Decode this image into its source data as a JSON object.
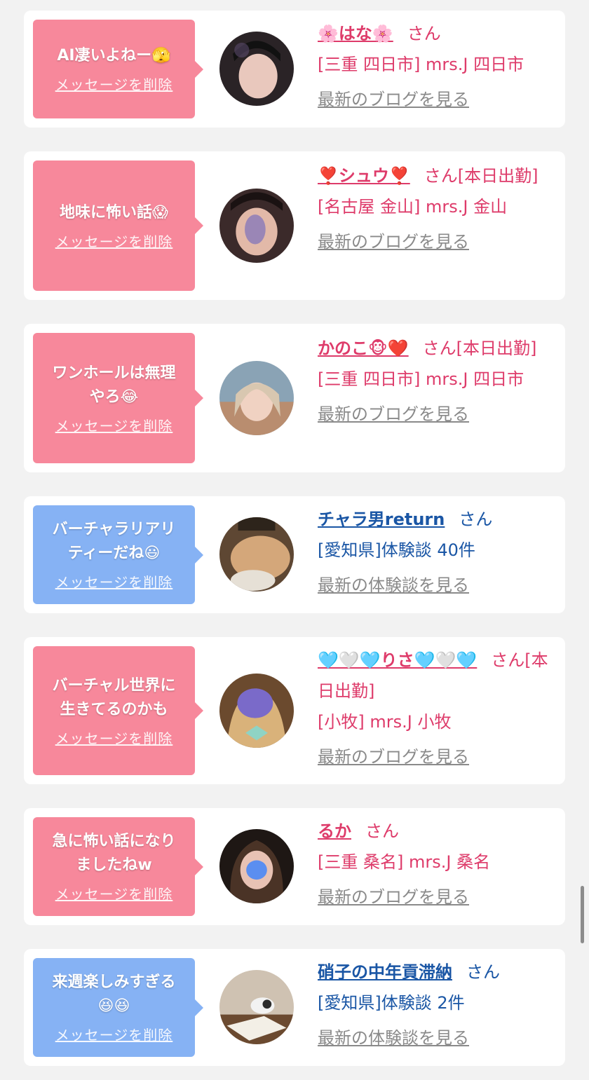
{
  "delete_label": "メッセージを削除",
  "cards": [
    {
      "theme": "pink",
      "message": "AI凄いよねー🫣",
      "name": "🌸はな🌸",
      "san": "さん",
      "line2": "[三重 四日市] mrs.J 四日市",
      "link": "最新のブログを見る"
    },
    {
      "theme": "pink",
      "message": "地味に怖い話😱",
      "name": "❣️シュウ❣️",
      "san": "さん[本日出勤]",
      "line2": "[名古屋 金山] mrs.J 金山",
      "link": "最新のブログを見る"
    },
    {
      "theme": "pink",
      "message": "ワンホールは無理\nやろ😂",
      "name": "かのこ🐵❤️",
      "san": "さん[本日出勤]",
      "line2": "[三重 四日市] mrs.J 四日市",
      "link": "最新のブログを見る"
    },
    {
      "theme": "blue",
      "message": "バーチャラリアリ\nティーだね😃",
      "name": "チャラ男return",
      "san": "さん",
      "line2": "[愛知県]体験談 40件",
      "link": "最新の体験談を見る"
    },
    {
      "theme": "pink",
      "message": "バーチャル世界に\n生きてるのかも",
      "name": "🩵🤍🩵りさ🩵🤍🩵",
      "san": "さん[本日出勤]",
      "line2": "[小牧] mrs.J 小牧",
      "link": "最新のブログを見る"
    },
    {
      "theme": "pink",
      "message": "急に怖い話になり\nましたねw",
      "name": "るか",
      "san": "さん",
      "line2": "[三重 桑名] mrs.J 桑名",
      "link": "最新のブログを見る"
    },
    {
      "theme": "blue",
      "message": "来週楽しみすぎる\n😆😆",
      "name": "硝子の中年貢滞納",
      "san": "さん",
      "line2": "[愛知県]体験談 2件",
      "link": "最新の体験談を見る"
    }
  ]
}
